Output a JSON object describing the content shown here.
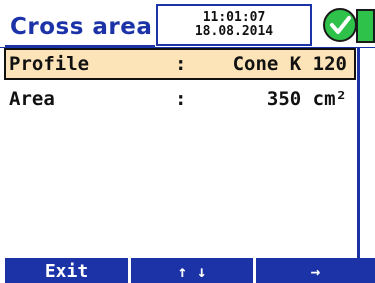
{
  "header": {
    "title": "Cross area",
    "time": "11:01:07",
    "date": "18.08.2014",
    "status_icon": "check-circle-icon",
    "battery_icon": "battery-icon"
  },
  "rows": [
    {
      "label": "Profile",
      "colon": ":",
      "value": "Cone K 120",
      "selected": true
    },
    {
      "label": "Area",
      "colon": ":",
      "value": "350 cm²",
      "selected": false
    }
  ],
  "softkeys": {
    "exit_label": "Exit",
    "updown_label": "↑ ↓",
    "next_label": "→"
  },
  "colors": {
    "accent": "#1c33a8",
    "selection": "#fde4b8",
    "status_ok": "#2fc24a"
  }
}
